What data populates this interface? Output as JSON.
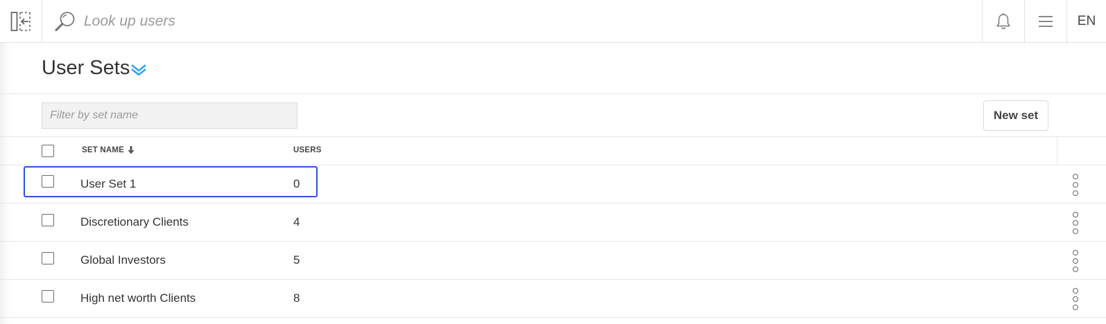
{
  "topbar": {
    "search_placeholder": "Look up users",
    "language": "EN"
  },
  "page": {
    "title": "User Sets",
    "accent_color": "#2ea3f2"
  },
  "toolbar": {
    "filter_placeholder": "Filter by set name",
    "new_set_label": "New set"
  },
  "table": {
    "columns": [
      "SET NAME",
      "USERS"
    ],
    "sort_column": "SET NAME",
    "rows": [
      {
        "name": "User Set 1",
        "users": "0",
        "highlighted": true
      },
      {
        "name": "Discretionary Clients",
        "users": "4"
      },
      {
        "name": "Global Investors",
        "users": "5"
      },
      {
        "name": "High net worth Clients",
        "users": "8"
      }
    ]
  },
  "icons": {
    "collapse": "sidebar-collapse-icon",
    "search": "search-icon",
    "notifications": "bell-icon",
    "menu": "hamburger-menu-icon",
    "title_toggle": "double-chevron-down-icon",
    "sort": "sort-down-arrow-icon",
    "row_actions": "vertical-dots-icon"
  },
  "highlight_color": "#2f4fe0"
}
